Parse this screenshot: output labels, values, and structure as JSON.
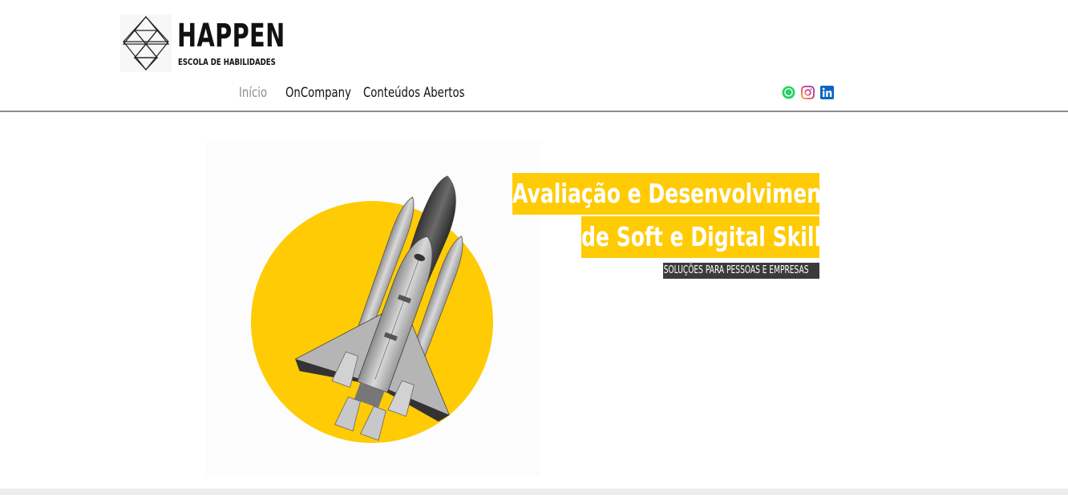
{
  "brand": {
    "name": "HAPPEN",
    "subtitle": "ESCOLA DE HABILIDADES"
  },
  "nav": {
    "items": [
      {
        "label": "Início",
        "active": true
      },
      {
        "label": "OnCompany",
        "active": false
      },
      {
        "label": "Conteúdos Abertos",
        "active": false
      }
    ]
  },
  "social": {
    "icons": [
      "whatsapp-icon",
      "instagram-icon",
      "linkedin-icon"
    ]
  },
  "hero": {
    "headline_line1": "Avaliação e Desenvolvimento",
    "headline_line2": "de Soft e Digital Skills",
    "tagline": "SOLUÇÕES PARA PESSOAS E EMPRESAS",
    "image": "space-shuttle-on-yellow-circle"
  },
  "colors": {
    "accent_yellow": "#ffcb05",
    "tagline_bg": "#3b3b3b",
    "nav_active": "#8d8d8d",
    "whatsapp": "#25d366",
    "linkedin": "#0a66c2"
  }
}
